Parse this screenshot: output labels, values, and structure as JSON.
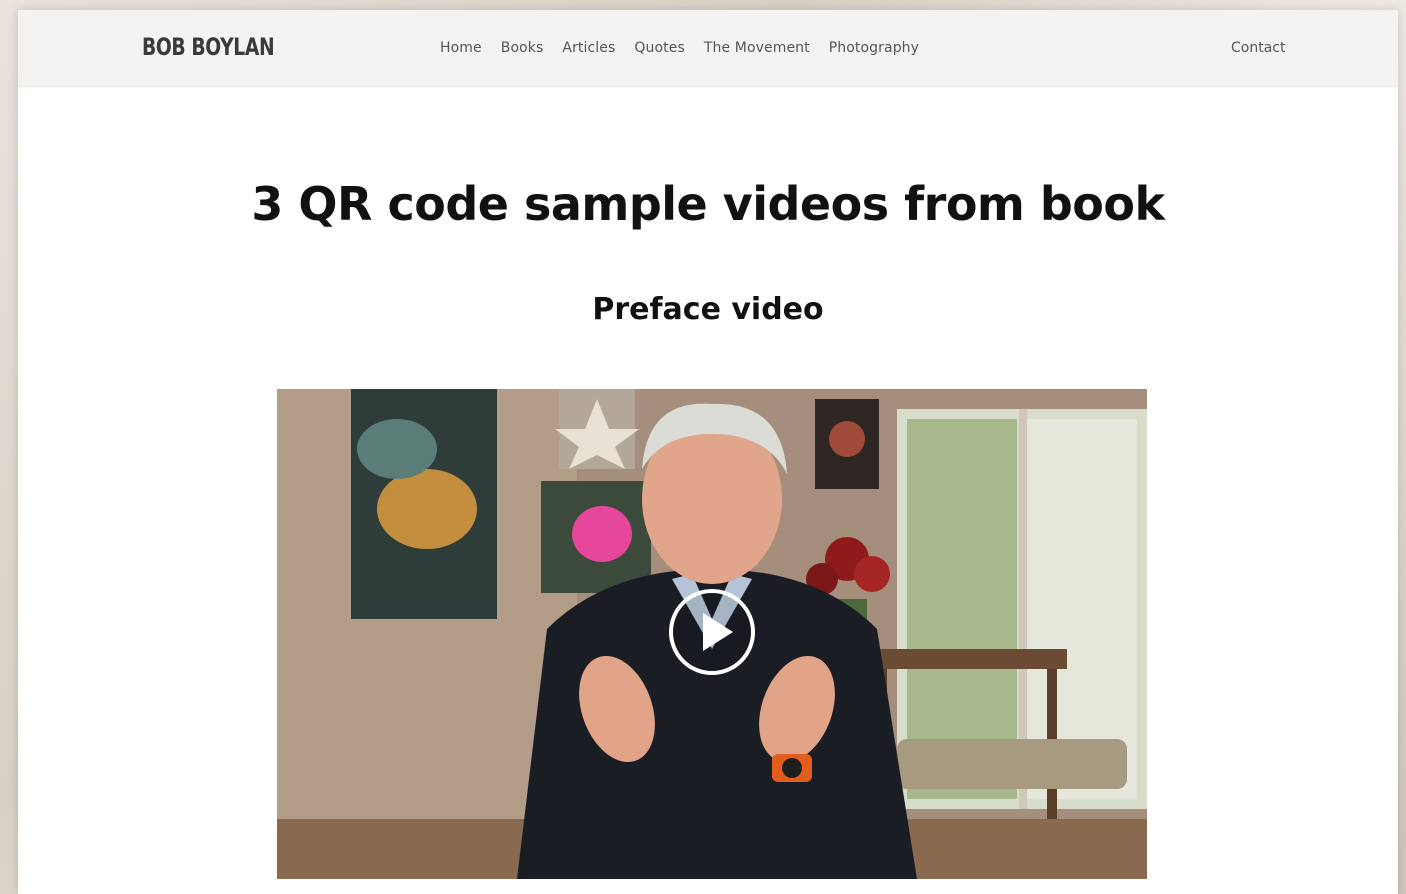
{
  "site": {
    "logo": "BOB BOYLAN"
  },
  "nav": {
    "links": [
      "Home",
      "Books",
      "Articles",
      "Quotes",
      "The Movement",
      "Photography"
    ],
    "contact": "Contact"
  },
  "main": {
    "title": "3 QR code sample videos from book",
    "section_title": "Preface video"
  },
  "video": {
    "play_icon": "play-icon"
  },
  "colors": {
    "nav_background": "#f5f3f1",
    "text_dark": "#111111",
    "nav_text": "#555555"
  }
}
